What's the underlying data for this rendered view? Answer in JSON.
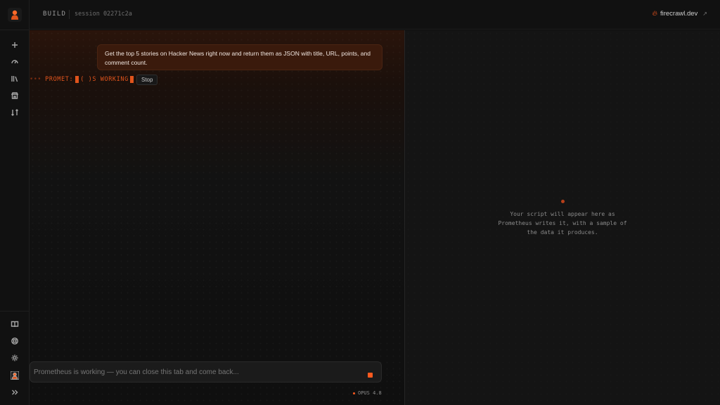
{
  "header": {
    "mode_label": "BUILD",
    "session_label": "session 02271c2a",
    "brand_link": "firecrawl.dev"
  },
  "rail": {
    "top_items": [
      "new-icon",
      "gauge-icon",
      "library-icon",
      "store-icon",
      "swap-icon"
    ],
    "bottom_items": [
      "book-icon",
      "help-icon",
      "settings-icon",
      "avatar",
      "expand-icon"
    ]
  },
  "chat": {
    "user_message": "Get the top 5 stories on Hacker News right now and return them as JSON with title, URL, points, and comment count.",
    "status_text": "PROMET:",
    "status_text2": "( )S WORKING",
    "stop_label": "Stop",
    "composer_placeholder": "Prometheus is working — you can close this tab and come back...",
    "model_label": "OPUS 4.8"
  },
  "preview": {
    "empty_message": "Your script will appear here as Prometheus writes it, with a sample of the data it produces."
  },
  "colors": {
    "accent": "#ff5a1f",
    "background": "#0f0f0f"
  }
}
